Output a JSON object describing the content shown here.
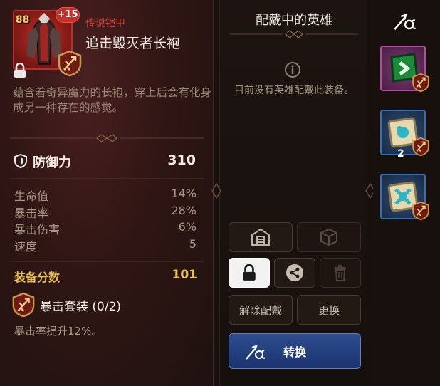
{
  "item": {
    "level": "88",
    "enhance": "+15",
    "rarity": "传说铠甲",
    "name": "追击毁灭者长袍",
    "description": "蕴含着奇异魔力的长袍，穿上后会有化身成另一种存在的感觉。"
  },
  "main_stat": {
    "label": "防御力",
    "value": "310"
  },
  "substats": [
    {
      "label": "生命值",
      "value": "14%"
    },
    {
      "label": "暴击率",
      "value": "28%"
    },
    {
      "label": "暴击伤害",
      "value": "6%"
    },
    {
      "label": "速度",
      "value": "5"
    }
  ],
  "score": {
    "label": "装备分数",
    "value": "101"
  },
  "set": {
    "name": "暴击套装 (0/2)",
    "effect": "暴击率提升12%。"
  },
  "equipped_panel": {
    "title": "配戴中的英雄",
    "empty_message": "目前没有英雄配戴此装备。",
    "unequip_label": "解除配戴",
    "change_label": "更换",
    "convert_label": "转换"
  },
  "inventory": {
    "slot2_count": "2"
  },
  "colors": {
    "rarity_red": "#d6453c",
    "score_gold": "#e7c25b",
    "primary_blue": "#2d4d8d"
  },
  "icons": [
    "lock-icon",
    "crit-set-icon",
    "shield-icon",
    "info-icon",
    "storage-icon",
    "random-box-icon",
    "share-icon",
    "trash-icon",
    "convert-icon"
  ]
}
